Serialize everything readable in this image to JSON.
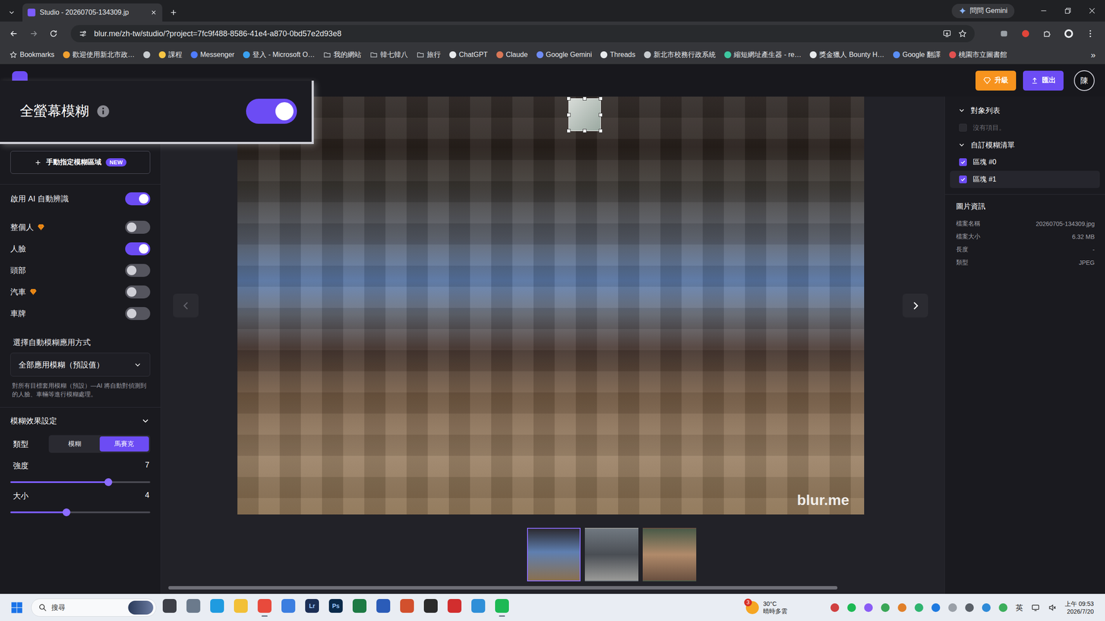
{
  "browser": {
    "tabs": [
      {
        "title": "Studio - 20260705-134309.jp",
        "selected": true
      }
    ],
    "gemini_button": "問問 Gemini",
    "url": "blur.me/zh-tw/studio/?project=7fc9f488-8586-41e4-a870-0bd57e2d93e8",
    "bookmarks": [
      {
        "label": "Bookmarks",
        "kind": "star",
        "color": "#e8eaed"
      },
      {
        "label": "歡迎使用新北市政…",
        "kind": "site",
        "color": "#f0a030"
      },
      {
        "label": "",
        "kind": "site",
        "color": "#c8ccd0"
      },
      {
        "label": "課程",
        "kind": "site",
        "color": "#f6c544"
      },
      {
        "label": "Messenger",
        "kind": "site",
        "color": "#4f7cff"
      },
      {
        "label": "登入 - Microsoft O…",
        "kind": "site",
        "color": "#3aa0f0"
      },
      {
        "label": "我的網站",
        "kind": "folder",
        "color": "#c8ccd0"
      },
      {
        "label": "韓七韓八",
        "kind": "folder",
        "color": "#c8ccd0"
      },
      {
        "label": "旅行",
        "kind": "folder",
        "color": "#c8ccd0"
      },
      {
        "label": "ChatGPT",
        "kind": "site",
        "color": "#e8eaed"
      },
      {
        "label": "Claude",
        "kind": "site",
        "color": "#d97757"
      },
      {
        "label": "Google Gemini",
        "kind": "site",
        "color": "#6f8cf5"
      },
      {
        "label": "Threads",
        "kind": "site",
        "color": "#e8eaed"
      },
      {
        "label": "新北市校務行政系統",
        "kind": "site",
        "color": "#c8ccd0"
      },
      {
        "label": "縮短網址產生器 - re…",
        "kind": "site",
        "color": "#3ec7a0"
      },
      {
        "label": "獎金獵人 Bounty H…",
        "kind": "site",
        "color": "#e8eaed"
      },
      {
        "label": "Google 翻譯",
        "kind": "site",
        "color": "#5a8ef5"
      },
      {
        "label": "桃園市立圖書館",
        "kind": "site",
        "color": "#e05050"
      }
    ],
    "more": "»"
  },
  "app": {
    "header": {
      "upgrade": "升級",
      "export": "匯出",
      "avatar": "陳"
    },
    "popup": {
      "title": "全螢幕模糊",
      "on": true
    },
    "sidebar": {
      "manual_button": {
        "label": "手動指定模糊區域",
        "badge": "NEW"
      },
      "toggles": [
        {
          "label": "啟用 AI 自動辨識",
          "on": true,
          "premium": false
        },
        {
          "label": "整個人",
          "on": false,
          "premium": true
        },
        {
          "label": "人臉",
          "on": true,
          "premium": false
        },
        {
          "label": "頭部",
          "on": false,
          "premium": false
        },
        {
          "label": "汽車",
          "on": false,
          "premium": true
        },
        {
          "label": "車牌",
          "on": false,
          "premium": false
        }
      ],
      "apply_mode": {
        "heading": "選擇自動模糊應用方式",
        "value": "全部應用模糊（預設值）",
        "description": "對所有目標套用模糊（預設）—AI 將自動對偵測到的人臉、車輛等進行模糊處理。"
      },
      "effect": {
        "heading": "模糊效果設定",
        "expanded": true,
        "type_label": "類型",
        "types": [
          {
            "label": "模糊",
            "selected": false
          },
          {
            "label": "馬賽克",
            "selected": true
          }
        ],
        "sliders": [
          {
            "label": "強度",
            "value": "7",
            "level": 0.7
          },
          {
            "label": "大小",
            "value": "4",
            "level": 0.4
          }
        ]
      }
    },
    "canvas": {
      "watermark": "blur.me",
      "prev_disabled": true,
      "next_disabled": false,
      "thumbnails": [
        {
          "selected": true
        },
        {
          "selected": false
        },
        {
          "selected": false
        }
      ],
      "scrollbar": {
        "level": 0.86
      }
    },
    "right_panel": {
      "object_list": {
        "heading": "對象列表",
        "expanded": true,
        "empty": "沒有項目。",
        "checked": false,
        "disabled": true
      },
      "custom_list": {
        "heading": "自訂模糊清單",
        "expanded": true,
        "items": [
          {
            "label": "區塊 #0",
            "checked": true,
            "selected": false
          },
          {
            "label": "區塊 #1",
            "checked": true,
            "selected": true
          }
        ]
      },
      "image_info": {
        "heading": "圖片資訊",
        "rows": [
          {
            "label": "檔案名稱",
            "value": "20260705-134309.jpg"
          },
          {
            "label": "檔案大小",
            "value": "6.32 MB"
          },
          {
            "label": "長度",
            "value": "-"
          },
          {
            "label": "類型",
            "value": "JPEG"
          }
        ]
      }
    }
  },
  "taskbar": {
    "search": "搜尋",
    "apps": [
      {
        "label": "",
        "color": "#3d3f47",
        "active": false
      },
      {
        "label": "",
        "color": "#6b7a8c",
        "active": false
      },
      {
        "label": "",
        "color": "#1f9be0",
        "active": false
      },
      {
        "label": "",
        "color": "#f2c037",
        "active": false
      },
      {
        "label": "",
        "color": "#e84a3c",
        "active": true
      },
      {
        "label": "",
        "color": "#3b7ee0",
        "active": false
      },
      {
        "label": "Lr",
        "color": "#1c2f55",
        "active": false
      },
      {
        "label": "Ps",
        "color": "#0a2a4a",
        "active": false
      },
      {
        "label": "",
        "color": "#1d7a44",
        "active": false
      },
      {
        "label": "",
        "color": "#2b5cb8",
        "active": false
      },
      {
        "label": "",
        "color": "#d2502d",
        "active": false
      },
      {
        "label": "",
        "color": "#2b2b2b",
        "active": false
      },
      {
        "label": "",
        "color": "#d22e2e",
        "active": false
      },
      {
        "label": "",
        "color": "#2f8fd8",
        "active": false
      },
      {
        "label": "",
        "color": "#1db954",
        "active": true
      }
    ],
    "weather": {
      "temp": "30°C",
      "desc": "晴時多雲",
      "badge": "3"
    },
    "tray": [
      {
        "color": "#d04040"
      },
      {
        "color": "#1db954"
      },
      {
        "color": "#8a5cf5"
      },
      {
        "color": "#3aa657"
      },
      {
        "color": "#e0802a"
      },
      {
        "color": "#2fb470"
      },
      {
        "color": "#1e7ae0"
      },
      {
        "color": "#9aa0a8"
      },
      {
        "color": "#5a6068"
      },
      {
        "color": "#2e8ad8"
      },
      {
        "color": "#3cae5c"
      }
    ],
    "ime": "英",
    "time": "上午 09:53",
    "date": "2026/7/20"
  }
}
